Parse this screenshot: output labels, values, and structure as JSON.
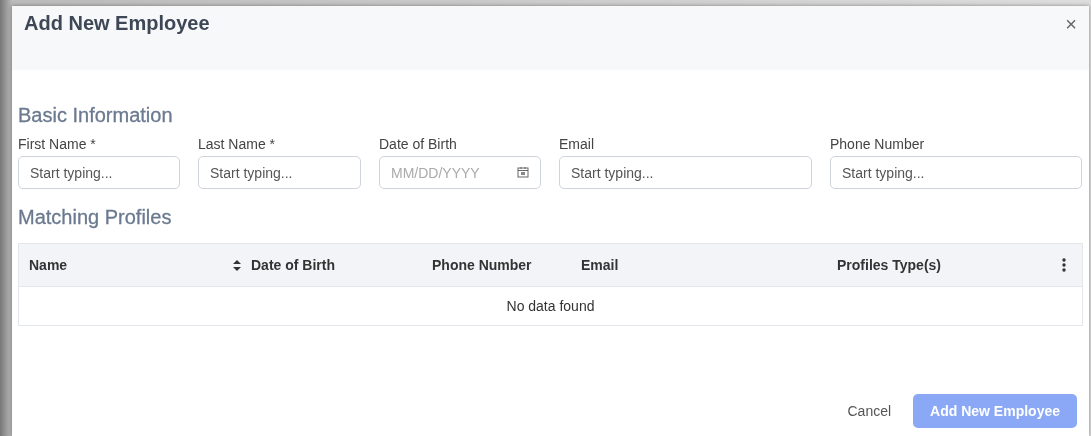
{
  "dialog": {
    "title": "Add New Employee",
    "close": "×"
  },
  "basic_information": {
    "heading": "Basic Information",
    "fields": [
      {
        "label": "First Name *",
        "placeholder": "Start typing...",
        "kind": "text"
      },
      {
        "label": "Last Name *",
        "placeholder": "Start typing...",
        "kind": "text"
      },
      {
        "label": "Date of Birth",
        "placeholder": "MM/DD/YYYY",
        "kind": "date"
      },
      {
        "label": "Email",
        "placeholder": "Start typing...",
        "kind": "text"
      },
      {
        "label": "Phone Number",
        "placeholder": "Start typing...",
        "kind": "text"
      }
    ]
  },
  "matching_profiles": {
    "heading": "Matching Profiles",
    "table": {
      "columns": [
        {
          "label": "Name",
          "sortable": true
        },
        {
          "label": "Date of Birth",
          "sortable": false
        },
        {
          "label": "Phone Number",
          "sortable": false
        },
        {
          "label": "Email",
          "sortable": false
        },
        {
          "label": "Profiles Type(s)",
          "sortable": false
        }
      ],
      "empty_message": "No data found"
    }
  },
  "buttons": [
    {
      "label": "Cancel",
      "kind": "link",
      "disabled": false
    },
    {
      "label": "Add New Employee",
      "kind": "primary",
      "disabled": true
    }
  ]
}
